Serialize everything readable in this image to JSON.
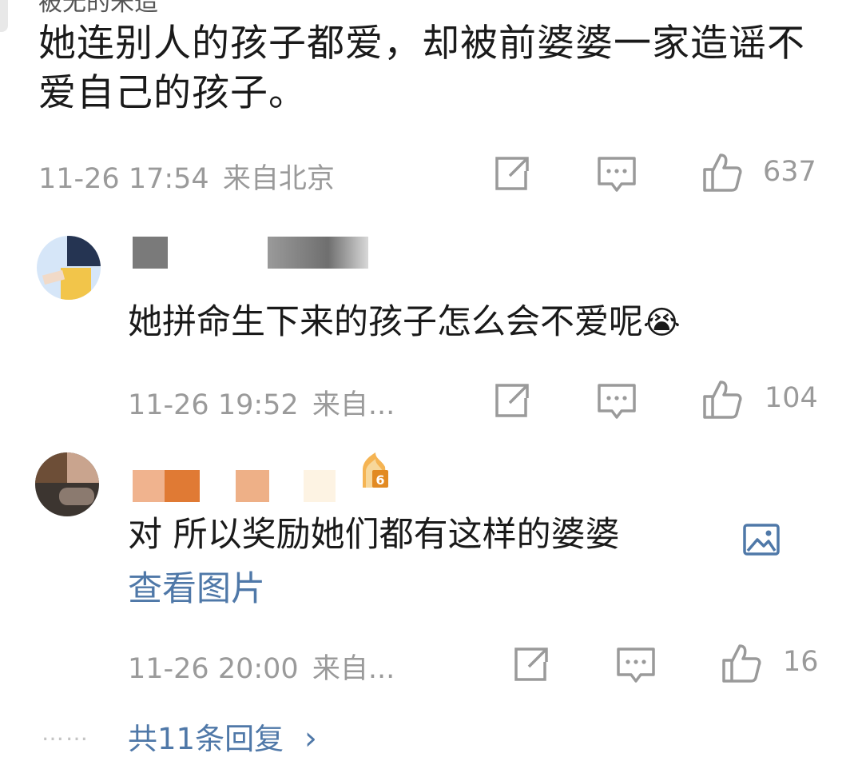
{
  "top_comment": {
    "username_partial": "被无的米造",
    "text": "她连别人的孩子都爱，却被前婆婆一家造谣不爱自己的孩子。",
    "time": "11-26 17:54",
    "location": "来自北京",
    "likes": "637"
  },
  "replies": [
    {
      "text": "她拼命生下来的孩子怎么会不爱呢",
      "emoji": "😭",
      "time": "11-26 19:52",
      "location": "来自...",
      "likes": "104"
    },
    {
      "level_badge": "6",
      "text": "对 所以奖励她们都有这样的婆婆",
      "view_image": "查看图片",
      "time": "11-26 20:00",
      "location": "来自...",
      "likes": "16"
    }
  ],
  "more": {
    "dots": "……",
    "label": "共11条回复",
    "chevron": "›"
  },
  "colors": {
    "link": "#4f78a8",
    "meta": "#9a9a9a",
    "text": "#1a1a1a"
  },
  "icons": [
    "share-icon",
    "comment-icon",
    "like-icon",
    "image-icon",
    "chevron-right-icon",
    "crying-emoji-icon"
  ]
}
